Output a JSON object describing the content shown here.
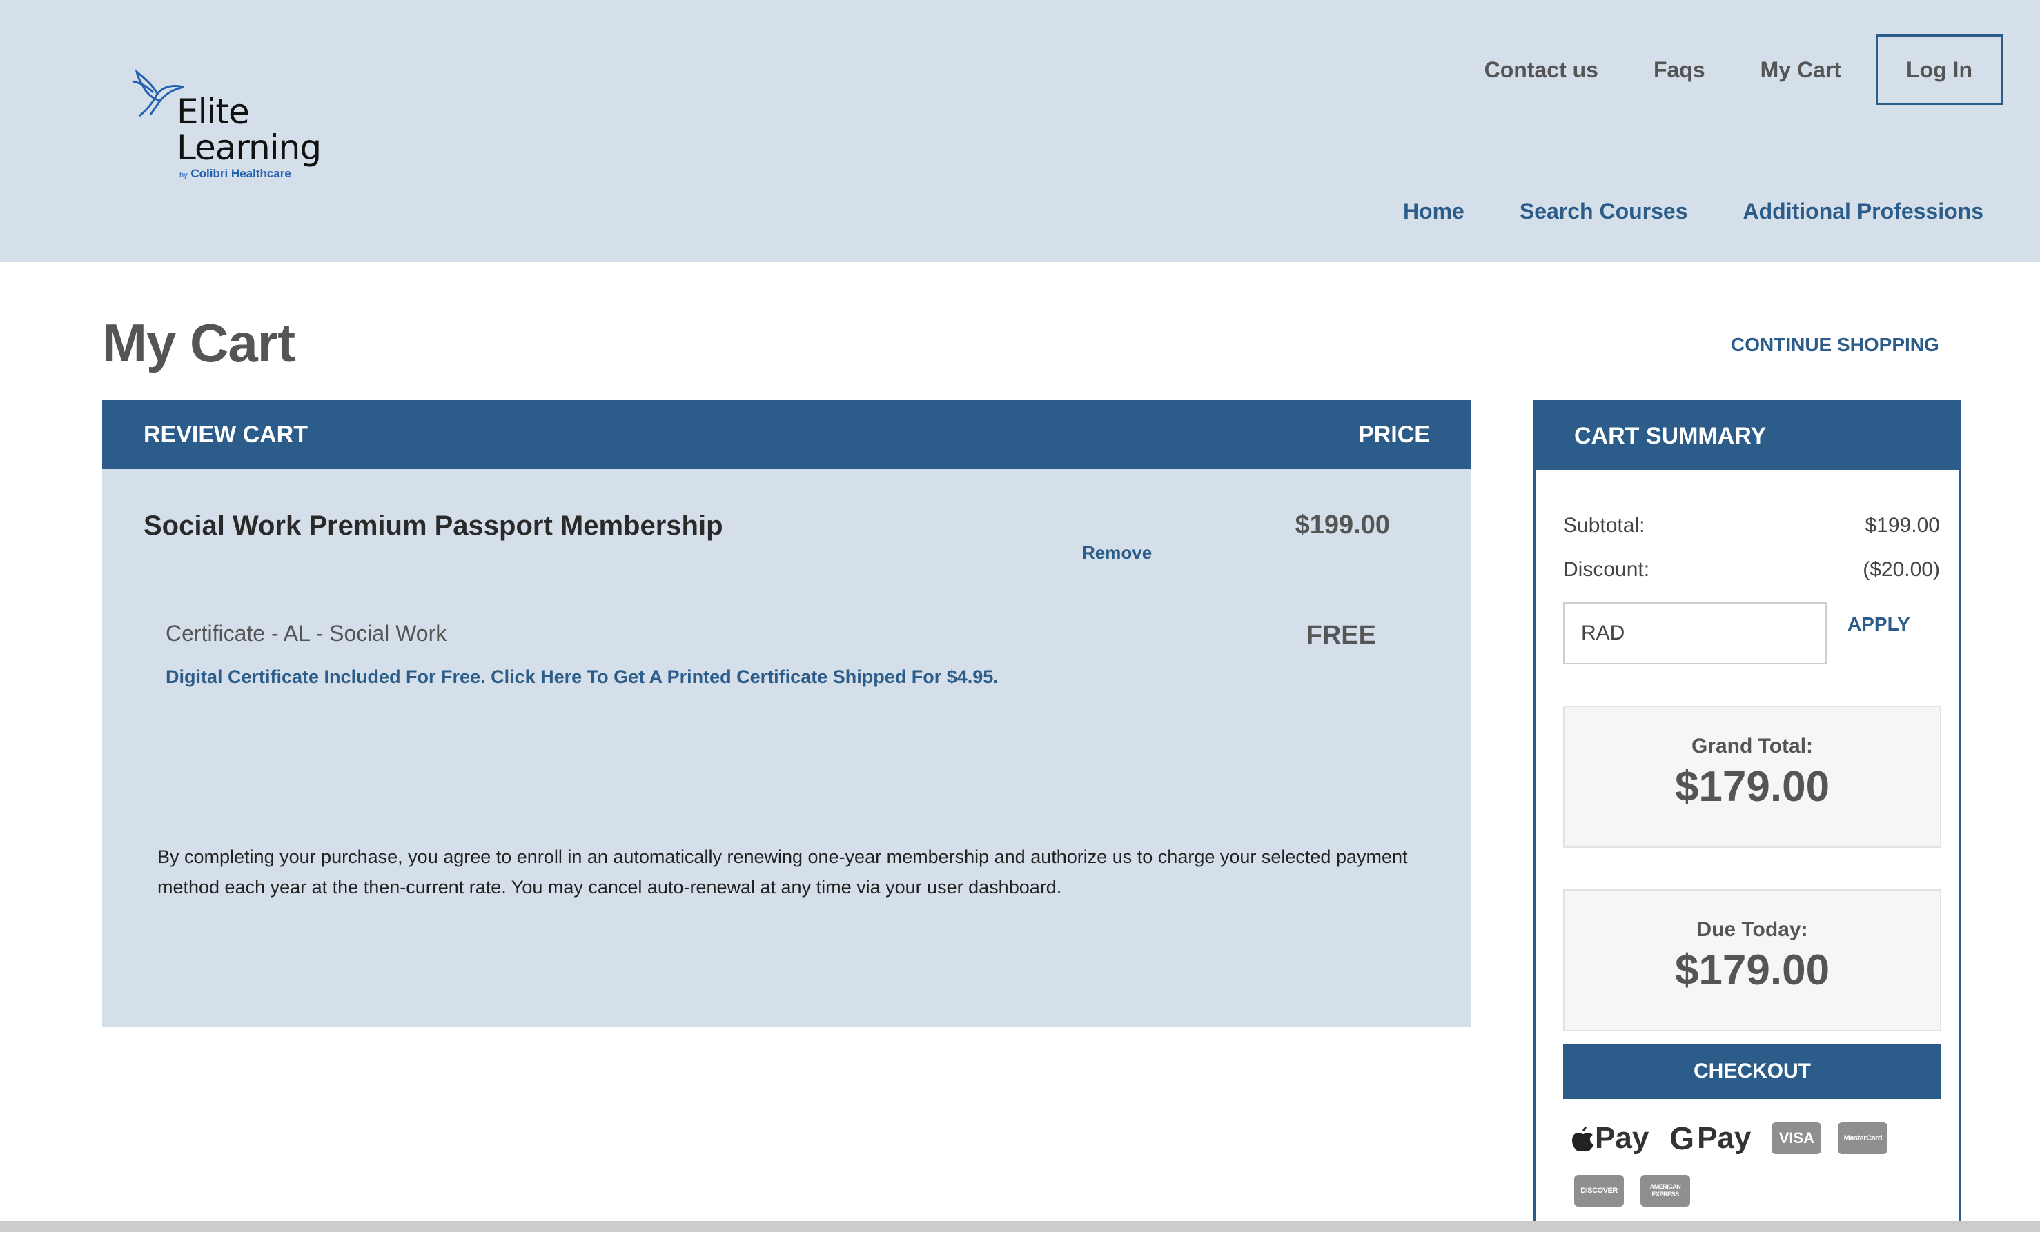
{
  "brand": {
    "name_line1": "Elite",
    "name_line2": "Learning",
    "sub_by": "by",
    "sub_name": "Colibri Healthcare"
  },
  "top_nav": {
    "contact": "Contact us",
    "faqs": "Faqs",
    "my_cart": "My Cart",
    "login": "Log In"
  },
  "main_nav": {
    "home": "Home",
    "search": "Search Courses",
    "professions": "Additional Professions"
  },
  "page": {
    "title": "My Cart",
    "continue": "CONTINUE SHOPPING"
  },
  "review": {
    "header_left": "REVIEW CART",
    "header_right": "PRICE",
    "item_name": "Social Work Premium Passport Membership",
    "remove": "Remove",
    "item_price": "$199.00",
    "cert_name": "Certificate - AL - Social Work",
    "cert_price": "FREE",
    "cert_link": "Digital Certificate Included For Free. Click Here To Get A Printed Certificate Shipped For $4.95.",
    "terms": "By completing your purchase, you agree to enroll in an automatically renewing one-year membership and authorize us to charge your selected payment method each year at the then-current rate. You may cancel auto-renewal at any time via your user dashboard."
  },
  "summary": {
    "header": "CART SUMMARY",
    "subtotal_label": "Subtotal:",
    "subtotal_value": "$199.00",
    "discount_label": "Discount:",
    "discount_value": "($20.00)",
    "coupon_value": "RAD",
    "apply": "APPLY",
    "grand_total_label": "Grand Total:",
    "grand_total_value": "$179.00",
    "due_today_label": "Due Today:",
    "due_today_value": "$179.00",
    "checkout": "CHECKOUT"
  },
  "payments": {
    "apple_pay": "Pay",
    "google_pay": "Pay",
    "visa": "VISA",
    "mastercard": "MasterCard",
    "discover": "DISCOVER",
    "amex": "AMERICAN EXPRESS"
  },
  "colors": {
    "brand_blue": "#2c5d8a",
    "header_bg": "#d5dfe9"
  }
}
